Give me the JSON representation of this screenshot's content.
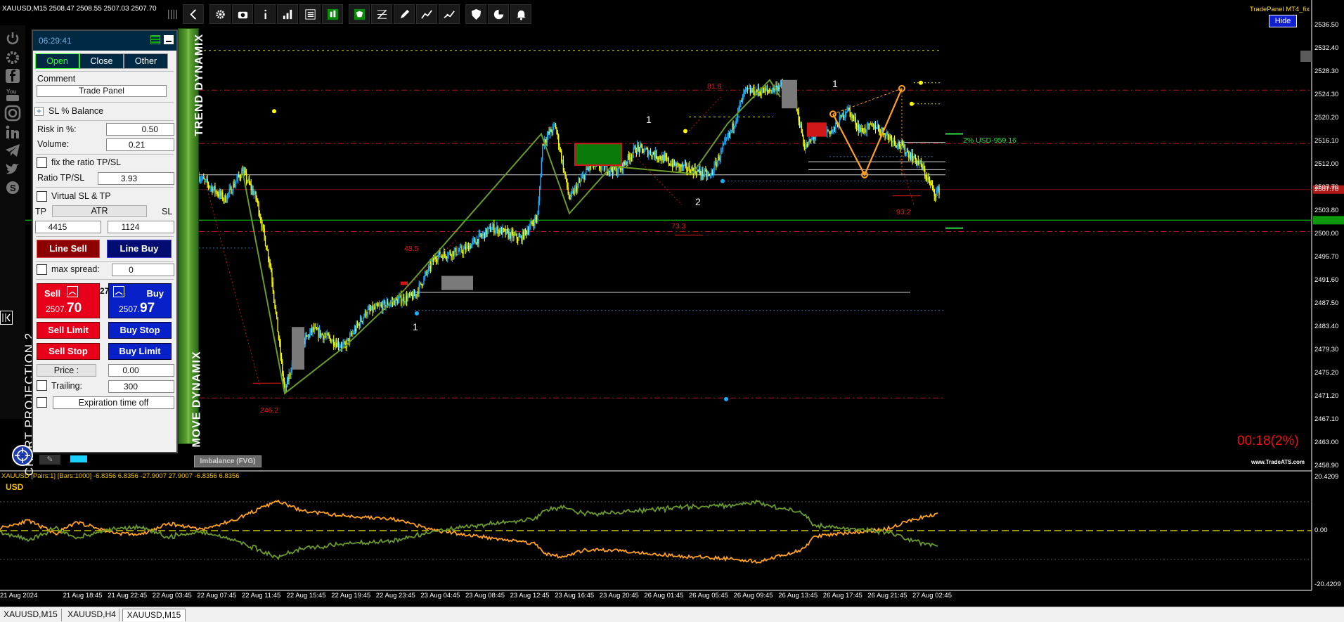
{
  "symbol_info": "XAUUSD,M15  2508.47 2508.55 2507.03 2507.70",
  "tradepanel_title": "TradePanel MT4_fix",
  "hide_label": "Hide",
  "watermark": "www.TradeATS.com",
  "timer": "00:18(2%)",
  "toolbar_icons": [
    "drag-handle-icon",
    "arrow-left-icon",
    "gear-icon",
    "camera-icon",
    "info-icon",
    "bar-chart-icon",
    "list-icon",
    "candles-icon",
    "bull-icon",
    "fib-icon",
    "pen-icon",
    "trend-up-icon",
    "trend-line-icon",
    "shield-icon",
    "pie-chart-icon",
    "bell-icon"
  ],
  "side_icons": [
    "power-icon",
    "settings-icon",
    "facebook-icon",
    "youtube-icon",
    "instagram-icon",
    "linkedin-icon",
    "telegram-icon",
    "twitter-icon",
    "skype-icon"
  ],
  "projection_label": "CHART PROJECTION 2",
  "trend_band_label": "TREND DYNAMIX",
  "move_band_label": "MOVE DYNAMIX",
  "panel": {
    "time": "06:29:41",
    "tabs": [
      "Open",
      "Close",
      "Other"
    ],
    "comment_label": "Comment",
    "comment_value": "Trade Panel",
    "sl_balance_label": "SL % Balance",
    "risk_label": "Risk in %:",
    "risk_value": "0.50",
    "volume_label": "Volume:",
    "volume_value": "0.21",
    "fix_ratio_label": "fix the ratio TP/SL",
    "ratio_label": "Ratio TP/SL",
    "ratio_value": "3.93",
    "virtual_label": "Virtual SL & TP",
    "tp_label": "TP",
    "atr_label": "ATR",
    "sl_label": "SL",
    "tp_value": "4415",
    "sl_value": "1124",
    "line_sell": "Line Sell",
    "line_buy": "Line Buy",
    "max_spread_label": "max spread:",
    "max_spread_value": "0",
    "sell_label": "Sell",
    "buy_label": "Buy",
    "spread": "27",
    "sell_price_small": "2507.",
    "sell_price_big": "70",
    "buy_price_small": "2507.",
    "buy_price_big": "97",
    "sell_limit": "Sell Limit",
    "buy_stop": "Buy Stop",
    "sell_stop": "Sell Stop",
    "buy_limit": "Buy Limit",
    "price_label": "Price :",
    "price_value": "0.00",
    "trailing_label": "Trailing:",
    "trailing_value": "300",
    "expiration": "Expiration time off"
  },
  "price_axis": [
    "2536.50",
    "2532.40",
    "2528.30",
    "2524.30",
    "2520.20",
    "2516.10",
    "2512.00",
    "2507.70",
    "2503.80",
    "2500.00",
    "2495.70",
    "2491.60",
    "2487.50",
    "2483.40",
    "2479.30",
    "2475.20",
    "2471.20",
    "2467.10",
    "2463.00",
    "2458.90"
  ],
  "current_price_tag": "2507.70",
  "green_price_tag": "2500.00",
  "time_axis": [
    "21 Aug 2024",
    "21 Aug 18:45",
    "21 Aug 22:45",
    "22 Aug 03:45",
    "22 Aug 07:45",
    "22 Aug 11:45",
    "22 Aug 15:45",
    "22 Aug 19:45",
    "22 Aug 23:45",
    "23 Aug 04:45",
    "23 Aug 08:45",
    "23 Aug 12:45",
    "23 Aug 16:45",
    "23 Aug 20:45",
    "26 Aug 01:45",
    "26 Aug 05:45",
    "26 Aug 09:45",
    "26 Aug 13:45",
    "26 Aug 17:45",
    "26 Aug 21:45",
    "27 Aug 02:45"
  ],
  "chart_annotations": {
    "label_1_low": "1",
    "label_1_mid": "1",
    "label_2": "2",
    "label_1_top": "1",
    "fib_81": "81.8",
    "fib_48": "48.5",
    "fib_73": "73.3",
    "fib_246": "246.2",
    "fib_93": "93.2",
    "sl_target": "2% USD-959.16",
    "imbalance_btn": "Imbalance (FVG)"
  },
  "indicator": {
    "title": "XAUUSD [Pairs:1] [Bars:1000] -6.8356 6.8356 -27.9007 27.9007 -6.8356 6.8356",
    "currency": "USD",
    "scale": [
      "20.4209",
      "0.00",
      "-20.4209"
    ]
  },
  "tabs": [
    "XAUUSD,M15",
    "XAUUSD,H4",
    "XAUUSD,M15"
  ],
  "colors": {
    "bull": "#1ab0ff",
    "bear": "#ffff00",
    "orange": "#ffa020",
    "olive": "#6a9a2a",
    "red_dash": "#b01818",
    "green_line": "#0c9a0c"
  }
}
